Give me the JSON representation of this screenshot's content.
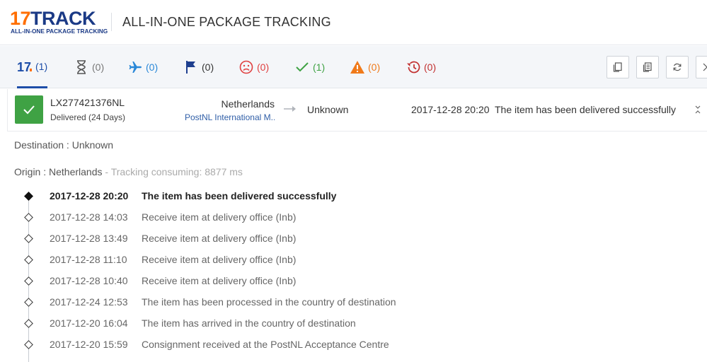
{
  "header": {
    "logo_number": "17",
    "logo_word": "TRACK",
    "logo_tagline": "ALL-IN-ONE PACKAGE TRACKING",
    "title": "ALL-IN-ONE PACKAGE TRACKING"
  },
  "filters": [
    {
      "icon": "seventeen-logo-icon",
      "count": "(1)",
      "color": "#1e4ea8",
      "active": true
    },
    {
      "icon": "hourglass-icon",
      "count": "(0)",
      "color": "#666666"
    },
    {
      "icon": "airplane-icon",
      "count": "(0)",
      "color": "#2a88d8"
    },
    {
      "icon": "flag-icon",
      "count": "(0)",
      "color": "#1e3f8f"
    },
    {
      "icon": "sad-face-icon",
      "count": "(0)",
      "color": "#e04040"
    },
    {
      "icon": "checkmark-icon",
      "count": "(1)",
      "color": "#3fa244"
    },
    {
      "icon": "warning-icon",
      "count": "(0)",
      "color": "#f07a1a"
    },
    {
      "icon": "history-clock-icon",
      "count": "(0)",
      "color": "#c23030"
    }
  ],
  "toolbar_icons": [
    "copy-icon",
    "copy-all-icon",
    "refresh-icon",
    "close-icon"
  ],
  "package": {
    "number": "LX277421376NL",
    "status": "Delivered (24 Days)",
    "status_color": "#3fa244",
    "origin_country": "Netherlands",
    "carrier": "PostNL International M...",
    "destination_country": "Unknown",
    "latest_time": "2017-12-28 20:20",
    "latest_event": "The item has been delivered successfully"
  },
  "details": {
    "destination_line": "Destination : Unknown",
    "origin_line": "Origin : Netherlands",
    "tracking_meta": " - Tracking consuming: 8877 ms"
  },
  "events": [
    {
      "time": "2017-12-28 20:20",
      "description": "The item has been delivered successfully"
    },
    {
      "time": "2017-12-28 14:03",
      "description": "Receive item at delivery office (Inb)"
    },
    {
      "time": "2017-12-28 13:49",
      "description": "Receive item at delivery office (Inb)"
    },
    {
      "time": "2017-12-28 11:10",
      "description": "Receive item at delivery office (Inb)"
    },
    {
      "time": "2017-12-28 10:40",
      "description": "Receive item at delivery office (Inb)"
    },
    {
      "time": "2017-12-24 12:53",
      "description": "The item has been processed in the country of destination"
    },
    {
      "time": "2017-12-20 16:04",
      "description": "The item has arrived in the country of destination"
    },
    {
      "time": "2017-12-20 15:59",
      "description": "Consignment received at the PostNL Acceptance Centre"
    }
  ]
}
